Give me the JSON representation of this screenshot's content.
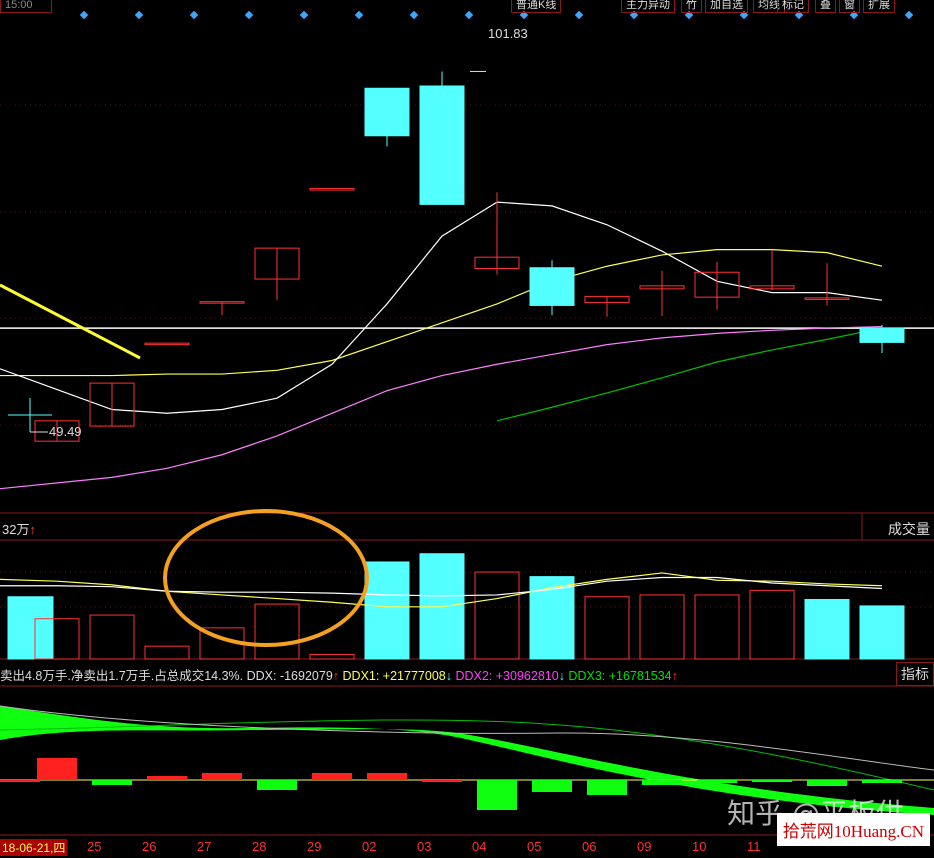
{
  "toolbar": {
    "left_clip": "15:00",
    "items": [
      "普通K线",
      "主力异动",
      "竹",
      "加自选",
      "均线",
      "标记",
      "叠",
      "窗",
      "扩展"
    ]
  },
  "price_panel": {
    "high_label": "101.83",
    "low_label": "49.49"
  },
  "volume_panel": {
    "left_label": "32万",
    "right_label": "成交量"
  },
  "ddx_bar": {
    "summary": "卖出4.8万手.净卖出1.7万手.占总成交14.3%.",
    "ddx": "DDX: -1692079",
    "ddx1": "DDX1: +21777008",
    "ddx2": "DDX2: +30962810",
    "ddx3": "DDX3: +16781534",
    "right_button": "指标"
  },
  "date_axis": {
    "first_date": "18-06-21,四",
    "days": [
      "25",
      "26",
      "27",
      "28",
      "29",
      "02",
      "03",
      "04",
      "05",
      "06",
      "09",
      "10",
      "11"
    ]
  },
  "watermark": {
    "zhihu": "知乎 @平板供",
    "site": "拾荒网10Huang.CN"
  },
  "colors": {
    "up": "#ff3232",
    "down": "#54ffff",
    "ma5": "#ffffff",
    "ma10": "#ffff54",
    "ma20": "#ff80ff",
    "ma60": "#00c000",
    "circle": "#f4a020"
  },
  "chart_data": {
    "type": "candlestick",
    "y_range": [
      45,
      106
    ],
    "candles": [
      {
        "date": "25",
        "open": 52.8,
        "close": 55.5,
        "high": 55.5,
        "low": 52.8
      },
      {
        "date": "26",
        "open": 54.8,
        "close": 60.5,
        "high": 60.5,
        "low": 54.8
      },
      {
        "date": "27",
        "open": 65.8,
        "close": 65.8,
        "high": 65.8,
        "low": 65.8
      },
      {
        "date": "28",
        "open": 71.3,
        "close": 71.3,
        "high": 71.3,
        "low": 69.5
      },
      {
        "date": "29",
        "open": 74.3,
        "close": 78.4,
        "high": 78.4,
        "low": 71.5
      },
      {
        "date": "02",
        "open": 86.3,
        "close": 86.3,
        "high": 86.3,
        "low": 86.3
      },
      {
        "date": "03",
        "open": 99.6,
        "close": 93.3,
        "high": 99.6,
        "low": 91.9
      },
      {
        "date": "04",
        "open": 99.9,
        "close": 84.2,
        "high": 101.83,
        "low": 84.2
      },
      {
        "date": "05",
        "open": 75.7,
        "close": 77.2,
        "high": 85.8,
        "low": 74.9
      },
      {
        "date": "06",
        "open": 75.8,
        "close": 70.8,
        "high": 76.8,
        "low": 69.5
      },
      {
        "date": "09",
        "open": 71.2,
        "close": 72.0,
        "high": 72.0,
        "low": 69.3
      },
      {
        "date": "10",
        "open": 73.0,
        "close": 73.4,
        "high": 75.4,
        "low": 69.4
      },
      {
        "date": "11",
        "open": 71.9,
        "close": 75.2,
        "high": 76.6,
        "low": 70.2
      },
      {
        "date": "12",
        "open": 73.0,
        "close": 73.4,
        "high": 78.2,
        "low": 72.8
      },
      {
        "date": "13",
        "open": 71.8,
        "close": 71.8,
        "high": 76.4,
        "low": 70.8
      },
      {
        "date": "16",
        "open": 67.8,
        "close": 65.9,
        "high": 68.2,
        "low": 64.5
      }
    ],
    "first_candle_low_marker": {
      "value": 49.49
    },
    "ma5": [
      62.4,
      57.0,
      56.5,
      57.0,
      58.5,
      63.0,
      71.0,
      80.0,
      84.5,
      84.0,
      81.5,
      78.0,
      74.0,
      72.5,
      72.5,
      71.5
    ],
    "ma10": [
      61.5,
      61.5,
      61.7,
      61.7,
      62.2,
      63.5,
      66.0,
      68.5,
      71.0,
      74.0,
      76.0,
      77.5,
      78.2,
      78.2,
      77.8,
      76.0
    ],
    "ma20": [
      46.5,
      48.0,
      49.2,
      51.0,
      53.5,
      56.5,
      59.5,
      61.5,
      63.0,
      64.3,
      65.6,
      66.5,
      67.1,
      67.5,
      67.8,
      68.0
    ],
    "ma60": [
      null,
      null,
      null,
      null,
      null,
      null,
      null,
      null,
      55.5,
      57.3,
      59.2,
      61.2,
      63.3,
      64.9,
      66.3,
      67.8
    ],
    "horizontal_line": 67.8,
    "volume": {
      "y_range": [
        0,
        130
      ],
      "bars": [
        68,
        44,
        48,
        14,
        34,
        60,
        5,
        106,
        115,
        95,
        90,
        68,
        70,
        70,
        75,
        65,
        58
      ],
      "colors": [
        "down",
        "up",
        "up",
        "up",
        "up",
        "up",
        "up",
        "down",
        "down",
        "up",
        "down",
        "up",
        "up",
        "up",
        "up",
        "down",
        "down"
      ],
      "ma5": [
        80,
        80,
        79,
        74,
        73,
        73,
        72,
        70,
        69,
        70,
        76,
        85,
        89,
        89,
        83,
        80,
        77
      ],
      "ma10": [
        87,
        85,
        81,
        74,
        70,
        66,
        62,
        57,
        57,
        66,
        78,
        87,
        94,
        86,
        85,
        82,
        80
      ]
    }
  }
}
